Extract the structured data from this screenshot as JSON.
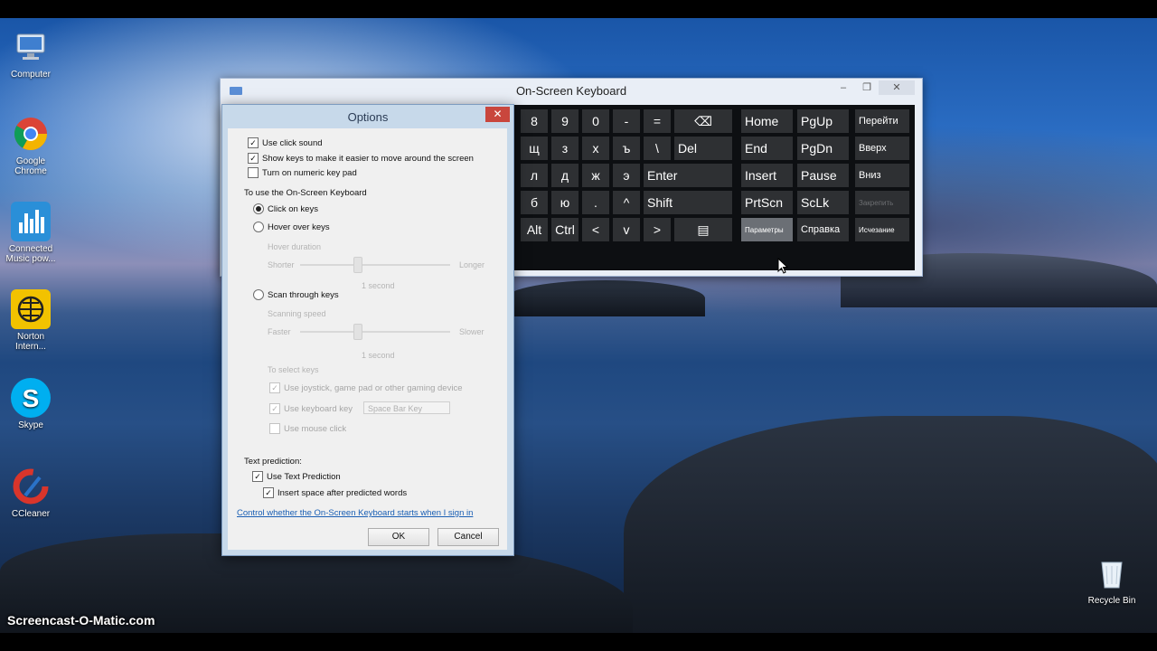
{
  "desktop": {
    "icons": [
      {
        "label": "Computer"
      },
      {
        "label": "Google Chrome"
      },
      {
        "label": "Connected Music pow..."
      },
      {
        "label": "Norton Intern..."
      },
      {
        "label": "Skype"
      },
      {
        "label": "CCleaner"
      },
      {
        "label": "Recycle Bin"
      }
    ],
    "watermark": "Screencast-O-Matic.com"
  },
  "osk": {
    "title": "On-Screen Keyboard",
    "caption": {
      "minimize": "–",
      "restore": "❐",
      "close": "✕"
    },
    "rows": [
      [
        "8",
        "9",
        "0",
        "-",
        "=",
        "⌫"
      ],
      [
        "щ",
        "з",
        "х",
        "ъ",
        "\\",
        "Del"
      ],
      [
        "л",
        "д",
        "ж",
        "э",
        "Enter"
      ],
      [
        "б",
        "ю",
        ".",
        "^",
        "Shift"
      ],
      [
        "Alt",
        "Ctrl",
        "<",
        "v",
        ">",
        "▤"
      ]
    ],
    "nav": [
      [
        "Home",
        "PgUp",
        "Перейти"
      ],
      [
        "End",
        "PgDn",
        "Вверх"
      ],
      [
        "Insert",
        "Pause",
        "Вниз"
      ],
      [
        "PrtScn",
        "ScLk",
        "Закрепить"
      ],
      [
        "Параметры",
        "Справка",
        "Исчезание"
      ]
    ]
  },
  "options": {
    "title": "Options",
    "close": "✕",
    "use_click_sound": "Use click sound",
    "show_keys": "Show keys to make it easier to move around the screen",
    "numeric_keypad": "Turn on numeric key pad",
    "use_osk_heading": "To use the On-Screen Keyboard",
    "click_on_keys": "Click on keys",
    "hover_over_keys": "Hover over keys",
    "hover_duration": "Hover duration",
    "shorter": "Shorter",
    "longer": "Longer",
    "hover_value": "1 second",
    "scan_through_keys": "Scan through keys",
    "scanning_speed": "Scanning speed",
    "faster": "Faster",
    "slower": "Slower",
    "scan_value": "1 second",
    "to_select_keys": "To select keys",
    "use_joystick": "Use joystick, game pad or other gaming device",
    "use_keyboard_key": "Use keyboard key",
    "keyboard_key_value": "Space Bar Key",
    "use_mouse_click": "Use mouse click",
    "text_prediction_heading": "Text prediction:",
    "use_text_prediction": "Use Text Prediction",
    "insert_space": "Insert space after predicted words",
    "control_link": "Control whether the On-Screen Keyboard starts when I sign in",
    "ok": "OK",
    "cancel": "Cancel"
  }
}
